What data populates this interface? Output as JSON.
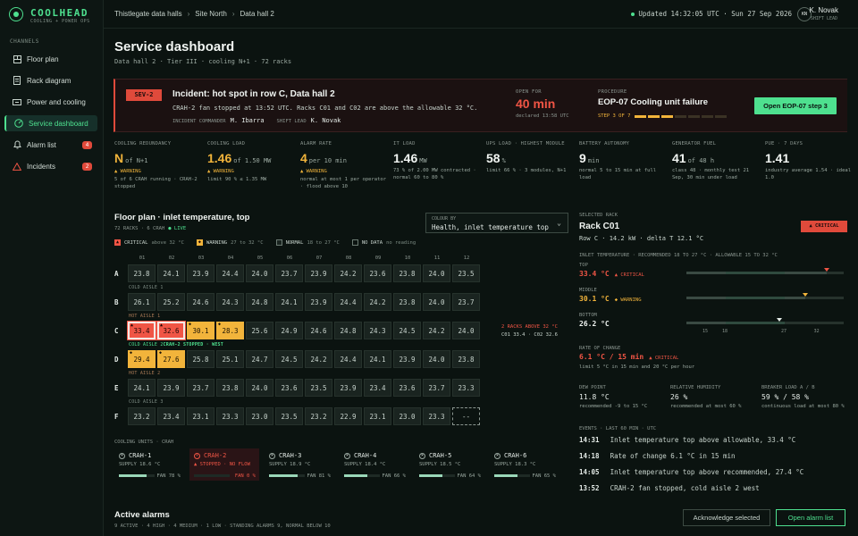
{
  "app": {
    "name": "COOLHEAD",
    "tagline": "COOLING + POWER OPS"
  },
  "sidebar": {
    "heading": "CHANNELS",
    "items": [
      {
        "label": "Floor plan",
        "icon": "floor-plan-icon"
      },
      {
        "label": "Rack diagram",
        "icon": "document-icon"
      },
      {
        "label": "Power and cooling",
        "icon": "power-icon"
      },
      {
        "label": "Service dashboard",
        "icon": "gauge-icon",
        "active": true
      },
      {
        "label": "Alarm list",
        "icon": "bell-icon",
        "badge": "4"
      },
      {
        "label": "Incidents",
        "icon": "warning-icon",
        "badge": "2"
      }
    ]
  },
  "header": {
    "breadcrumbs": [
      "Thistlegate data halls",
      "Site North",
      "Data hall 2"
    ],
    "updated": "Updated 14:32:05 UTC · Sun 27 Sep 2026",
    "user": {
      "initials": "KN",
      "name": "K. Novak",
      "role": "SHIFT LEAD"
    }
  },
  "page": {
    "title": "Service dashboard",
    "subtitle": "Data hall 2 · Tier III · cooling N+1 · 72 racks"
  },
  "incident": {
    "severity": "SEV-2",
    "title": "Incident: hot spot in row C, Data hall 2",
    "description": "CRAH-2 fan stopped at 13:52 UTC. Racks C01 and C02 are above the allowable 32 °C.",
    "commander_label": "INCIDENT COMMANDER",
    "commander": "M. Ibarra",
    "lead_label": "SHIFT LEAD",
    "lead": "K. Novak",
    "open_for_label": "OPEN FOR",
    "open_for": "40 min",
    "declared": "declared 13:58 UTC",
    "procedure_label": "PROCEDURE",
    "procedure": "EOP-07 Cooling unit failure",
    "step_text": "STEP 3 OF 7",
    "step_current": 3,
    "step_total": 7,
    "button": "Open EOP-07 step 3"
  },
  "kpis": [
    {
      "label": "COOLING REDUNDANCY",
      "value": "N",
      "unit": "of N+1",
      "color": "#f2b43b",
      "warn": "▲ WARNING",
      "note": "5 of 6 CRAH running · CRAH-2 stopped"
    },
    {
      "label": "COOLING LOAD",
      "value": "1.46",
      "unit": "of 1.50 MW",
      "color": "#f2b43b",
      "warn": "▲ WARNING",
      "note": "limit 90 % ≤ 1.35 MW"
    },
    {
      "label": "ALARM RATE",
      "value": "4",
      "unit": "per 10 min",
      "color": "#f2b43b",
      "warn": "▲ WARNING",
      "note": "normal at most 1 per operator · flood above 10"
    },
    {
      "label": "IT LOAD",
      "value": "1.46",
      "unit": "MW",
      "color": "#f1f5f2",
      "warn": "",
      "note": "73 % of 2.00 MW contracted · normal 60 to 80 %"
    },
    {
      "label": "UPS LOAD · HIGHEST MODULE",
      "value": "58",
      "unit": "%",
      "color": "#f1f5f2",
      "warn": "",
      "note": "limit 66 % · 3 modules, N+1"
    },
    {
      "label": "BATTERY AUTONOMY",
      "value": "9",
      "unit": "min",
      "color": "#f1f5f2",
      "warn": "",
      "note": "normal 5 to 15 min at full load"
    },
    {
      "label": "GENERATOR FUEL",
      "value": "41",
      "unit": "of 48 h",
      "color": "#f1f5f2",
      "warn": "",
      "note": "class 48 · monthly test 21 Sep, 30 min under load"
    },
    {
      "label": "PUE · 7 DAYS",
      "value": "1.41",
      "unit": "",
      "color": "#f1f5f2",
      "warn": "",
      "note": "industry average 1.54 · ideal 1.0"
    }
  ],
  "floor_plan": {
    "title": "Floor plan · inlet temperature, top",
    "subtitle": "72 RACKS · 6 CRAH",
    "live": "● LIVE",
    "color_by_label": "COLOUR BY",
    "color_by": "Health, inlet temperature top",
    "legend": [
      {
        "label": "CRITICAL",
        "range": "above 32 °C",
        "icon": "▲",
        "color": "#f05545"
      },
      {
        "label": "WARNING",
        "range": "27 to 32 °C",
        "icon": "◆",
        "color": "#f2b43b"
      },
      {
        "label": "NORMAL",
        "range": "18 to 27 °C",
        "icon": "",
        "color": "#1a2420"
      },
      {
        "label": "NO DATA",
        "range": "no reading",
        "icon": "",
        "color": "transparent"
      }
    ],
    "columns": [
      "01",
      "02",
      "03",
      "04",
      "05",
      "06",
      "07",
      "08",
      "09",
      "10",
      "11",
      "12"
    ],
    "rows": [
      {
        "id": "A",
        "cells": [
          "23.8",
          "24.1",
          "23.9",
          "24.4",
          "24.0",
          "23.7",
          "23.9",
          "24.2",
          "23.6",
          "23.8",
          "24.0",
          "23.5"
        ],
        "status": [
          "n",
          "n",
          "n",
          "n",
          "n",
          "n",
          "n",
          "n",
          "n",
          "n",
          "n",
          "n"
        ]
      },
      {
        "id": "B",
        "cells": [
          "26.1",
          "25.2",
          "24.6",
          "24.3",
          "24.8",
          "24.1",
          "23.9",
          "24.4",
          "24.2",
          "23.8",
          "24.0",
          "23.7"
        ],
        "status": [
          "n",
          "n",
          "n",
          "n",
          "n",
          "n",
          "n",
          "n",
          "n",
          "n",
          "n",
          "n"
        ]
      },
      {
        "id": "C",
        "cells": [
          "33.4",
          "32.6",
          "30.1",
          "28.3",
          "25.6",
          "24.9",
          "24.6",
          "24.8",
          "24.3",
          "24.5",
          "24.2",
          "24.0"
        ],
        "status": [
          "c",
          "c",
          "w",
          "w",
          "n",
          "n",
          "n",
          "n",
          "n",
          "n",
          "n",
          "n"
        ]
      },
      {
        "id": "D",
        "cells": [
          "29.4",
          "27.6",
          "25.8",
          "25.1",
          "24.7",
          "24.5",
          "24.2",
          "24.4",
          "24.1",
          "23.9",
          "24.0",
          "23.8"
        ],
        "status": [
          "w",
          "w",
          "n",
          "n",
          "n",
          "n",
          "n",
          "n",
          "n",
          "n",
          "n",
          "n"
        ]
      },
      {
        "id": "E",
        "cells": [
          "24.1",
          "23.9",
          "23.7",
          "23.8",
          "24.0",
          "23.6",
          "23.5",
          "23.9",
          "23.4",
          "23.6",
          "23.7",
          "23.3"
        ],
        "status": [
          "n",
          "n",
          "n",
          "n",
          "n",
          "n",
          "n",
          "n",
          "n",
          "n",
          "n",
          "n"
        ]
      },
      {
        "id": "F",
        "cells": [
          "23.2",
          "23.4",
          "23.1",
          "23.3",
          "23.0",
          "23.5",
          "23.2",
          "22.9",
          "23.1",
          "23.0",
          "23.3",
          "--"
        ],
        "status": [
          "n",
          "n",
          "n",
          "n",
          "n",
          "n",
          "n",
          "n",
          "n",
          "n",
          "n",
          "x"
        ]
      }
    ],
    "aisles": [
      "COLD AISLE 1",
      "HOT AISLE 1",
      "COLD AISLE 2",
      "HOT AISLE 2",
      "COLD AISLE 3"
    ],
    "aisle_alert": "CRAH-2 STOPPED · WEST",
    "row_note_line1": "2 RACKS ABOVE 32 °C",
    "row_note_line2": "C01 33.4 · C02 32.6"
  },
  "crah": {
    "label": "COOLING UNITS · CRAH",
    "units": [
      {
        "name": "CRAH-1",
        "supply": "SUPPLY 18.6 °C",
        "fan": "FAN 78 %",
        "fan_pct": 78,
        "failed": false
      },
      {
        "name": "CRAH-2",
        "supply": "▲ STOPPED · NO FLOW",
        "fan": "FAN 0 %",
        "fan_pct": 0,
        "failed": true
      },
      {
        "name": "CRAH-3",
        "supply": "SUPPLY 18.9 °C",
        "fan": "FAN 81 %",
        "fan_pct": 81,
        "failed": false
      },
      {
        "name": "CRAH-4",
        "supply": "SUPPLY 18.4 °C",
        "fan": "FAN 66 %",
        "fan_pct": 66,
        "failed": false
      },
      {
        "name": "CRAH-5",
        "supply": "SUPPLY 18.5 °C",
        "fan": "FAN 64 %",
        "fan_pct": 64,
        "failed": false
      },
      {
        "name": "CRAH-6",
        "supply": "SUPPLY 18.3 °C",
        "fan": "FAN 65 %",
        "fan_pct": 65,
        "failed": false
      }
    ]
  },
  "alarms": {
    "title": "Active alarms",
    "subtitle": "9 ACTIVE · 4 HIGH · 4 MEDIUM · 1 LOW · STANDING ALARMS 9, NORMAL BELOW 10",
    "ack_button": "Acknowledge selected",
    "open_button": "Open alarm list"
  },
  "rack": {
    "selected_label": "SELECTED RACK",
    "name": "Rack C01",
    "badge": "▲ CRITICAL",
    "meta": "Row C · 14.2 kW · delta T 12.1 °C",
    "inlet_label": "INLET TEMPERATURE · RECOMMENDED 18 TO 27 °C · ALLOWABLE 15 TO 32 °C",
    "temps": [
      {
        "label": "TOP",
        "value": "33.4 °C",
        "status": "▲ CRITICAL",
        "color": "#f05545",
        "reading": 33.4,
        "mark": "r"
      },
      {
        "label": "MIDDLE",
        "value": "30.1 °C",
        "status": "◆ WARNING",
        "color": "#f2b43b",
        "reading": 30.1,
        "mark": "a"
      },
      {
        "label": "BOTTOM",
        "value": "26.2 °C",
        "status": "",
        "color": "#f1f5f2",
        "reading": 26.2,
        "mark": "w"
      }
    ],
    "scale_ticks": [
      "15",
      "18",
      "27",
      "32"
    ],
    "rate_label": "RATE OF CHANGE",
    "rate_value": "6.1 °C / 15 min",
    "rate_status": "▲ CRITICAL",
    "rate_note": "limit 5 °C in 15 min and 20 °C per hour",
    "env": [
      {
        "label": "DEW POINT",
        "value": "11.8 °C",
        "note": "recommended -9 to 15 °C"
      },
      {
        "label": "RELATIVE HUMIDITY",
        "value": "26 %",
        "note": "recommended at most 60 %"
      },
      {
        "label": "BREAKER LOAD A / B",
        "value": "59 % / 58 %",
        "note": "continuous load at most 80 %"
      }
    ],
    "events_label": "EVENTS · LAST 60 MIN · UTC",
    "events": [
      {
        "time": "14:31",
        "text": "Inlet temperature top above allowable, 33.4 °C"
      },
      {
        "time": "14:18",
        "text": "Rate of change 6.1 °C in 15 min"
      },
      {
        "time": "14:05",
        "text": "Inlet temperature top above recommended, 27.4 °C"
      },
      {
        "time": "13:52",
        "text": "CRAH-2 fan stopped, cold aisle 2 west"
      }
    ]
  }
}
